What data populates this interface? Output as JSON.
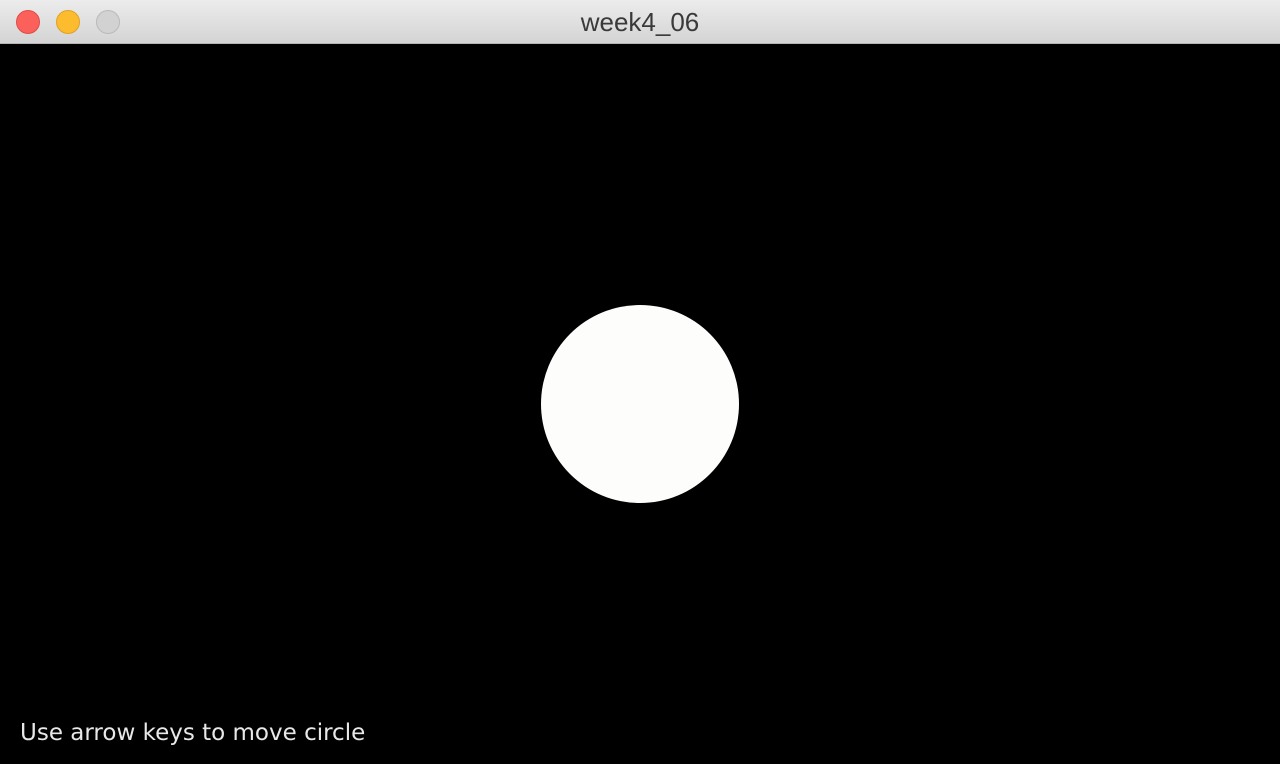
{
  "window": {
    "title": "week4_06",
    "buttons": {
      "close": "close-button",
      "minimize": "minimize-button",
      "zoom": "zoom-button"
    }
  },
  "sketch": {
    "background_color": "#000000",
    "circle_color": "#fdfdfb",
    "instruction": "Use arrow keys to move circle"
  }
}
